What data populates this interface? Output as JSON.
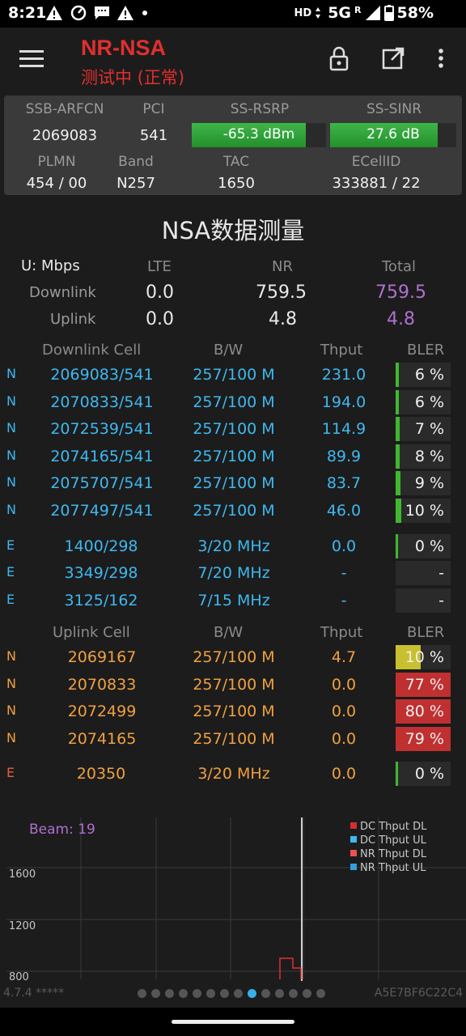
{
  "status": {
    "time": "8:21",
    "hd": "HD",
    "network": "5G",
    "roaming": "R",
    "battery": "58%"
  },
  "app": {
    "title": "NR-NSA",
    "subtitle": "测试中 (正常)",
    "icons": [
      "menu-icon",
      "lock-icon",
      "open-external-icon",
      "more-vert-icon"
    ]
  },
  "info": {
    "labels": {
      "arfcn": "SSB-ARFCN",
      "pci": "PCI",
      "rsrp": "SS-RSRP",
      "sinr": "SS-SINR",
      "plmn": "PLMN",
      "band": "Band",
      "tac": "TAC",
      "ecellid": "ECellID"
    },
    "values": {
      "arfcn": "2069083",
      "pci": "541",
      "rsrp": "-65.3 dBm",
      "sinr": "27.6 dB",
      "plmn": "454 / 00",
      "band": "N257",
      "tac": "1650",
      "ecellid": "333881 / 22"
    },
    "rsrp_fill": 0.85,
    "sinr_fill": 0.85,
    "bar_color": "#3fb64a"
  },
  "nsa": {
    "title": "NSA数据测量",
    "unit": "U: Mbps",
    "headers": {
      "lte": "LTE",
      "nr": "NR",
      "total": "Total"
    },
    "downlink": {
      "label": "Downlink",
      "lte": "0.0",
      "nr": "759.5",
      "total": "759.5"
    },
    "uplink": {
      "label": "Uplink",
      "lte": "0.0",
      "nr": "4.8",
      "total": "4.8"
    }
  },
  "dl_table": {
    "headers": {
      "cell": "Downlink Cell",
      "bw": "B/W",
      "thput": "Thput",
      "bler": "BLER"
    },
    "rows": [
      {
        "tag": "N",
        "cell": "2069083/541",
        "bw": "257/100 M",
        "thput": "231.0",
        "bler": "6 %",
        "level": 0.06,
        "color": "green"
      },
      {
        "tag": "N",
        "cell": "2070833/541",
        "bw": "257/100 M",
        "thput": "194.0",
        "bler": "6 %",
        "level": 0.06,
        "color": "green"
      },
      {
        "tag": "N",
        "cell": "2072539/541",
        "bw": "257/100 M",
        "thput": "114.9",
        "bler": "7 %",
        "level": 0.07,
        "color": "green"
      },
      {
        "tag": "N",
        "cell": "2074165/541",
        "bw": "257/100 M",
        "thput": "89.9",
        "bler": "8 %",
        "level": 0.08,
        "color": "green"
      },
      {
        "tag": "N",
        "cell": "2075707/541",
        "bw": "257/100 M",
        "thput": "83.7",
        "bler": "9 %",
        "level": 0.09,
        "color": "green"
      },
      {
        "tag": "N",
        "cell": "2077497/541",
        "bw": "257/100 M",
        "thput": "46.0",
        "bler": "10 %",
        "level": 0.1,
        "color": "green"
      },
      {
        "tag": "E",
        "cell": "1400/298",
        "bw": "3/20 MHz",
        "thput": "0.0",
        "bler": "0 %",
        "level": 0.0,
        "color": "green"
      },
      {
        "tag": "E",
        "cell": "3349/298",
        "bw": "7/20 MHz",
        "thput": "-",
        "bler": "-",
        "level": null,
        "color": "none"
      },
      {
        "tag": "E",
        "cell": "3125/162",
        "bw": "7/15 MHz",
        "thput": "-",
        "bler": "-",
        "level": null,
        "color": "none"
      }
    ]
  },
  "ul_table": {
    "headers": {
      "cell": "Uplink Cell",
      "bw": "B/W",
      "thput": "Thput",
      "bler": "BLER"
    },
    "rows": [
      {
        "tag": "N",
        "cell": "2069167",
        "bw": "257/100 M",
        "thput": "4.7",
        "bler": "10 %",
        "level": 0.45,
        "color": "yellow"
      },
      {
        "tag": "N",
        "cell": "2070833",
        "bw": "257/100 M",
        "thput": "0.0",
        "bler": "77 %",
        "level": 1.0,
        "color": "red"
      },
      {
        "tag": "N",
        "cell": "2072499",
        "bw": "257/100 M",
        "thput": "0.0",
        "bler": "80 %",
        "level": 1.0,
        "color": "red"
      },
      {
        "tag": "N",
        "cell": "2074165",
        "bw": "257/100 M",
        "thput": "0.0",
        "bler": "79 %",
        "level": 1.0,
        "color": "red"
      },
      {
        "tag": "E",
        "cell": "20350",
        "bw": "3/20 MHz",
        "thput": "0.0",
        "bler": "0 %",
        "level": 0.0,
        "color": "green"
      }
    ]
  },
  "chart": {
    "beam": "Beam: 19",
    "y_ticks": [
      "1600",
      "1200",
      "800"
    ],
    "legend": [
      {
        "name": "DC Thput DL",
        "color": "#d03030"
      },
      {
        "name": "DC Thput UL",
        "color": "#3fb8f0"
      },
      {
        "name": "NR Thput DL",
        "color": "#f05050"
      },
      {
        "name": "NR Thput UL",
        "color": "#30a0e0"
      }
    ]
  },
  "footer": {
    "version": "4.7.4 *****",
    "device_id": "A5E7BF6C22C4",
    "page_count": 14,
    "active_page": 9
  }
}
